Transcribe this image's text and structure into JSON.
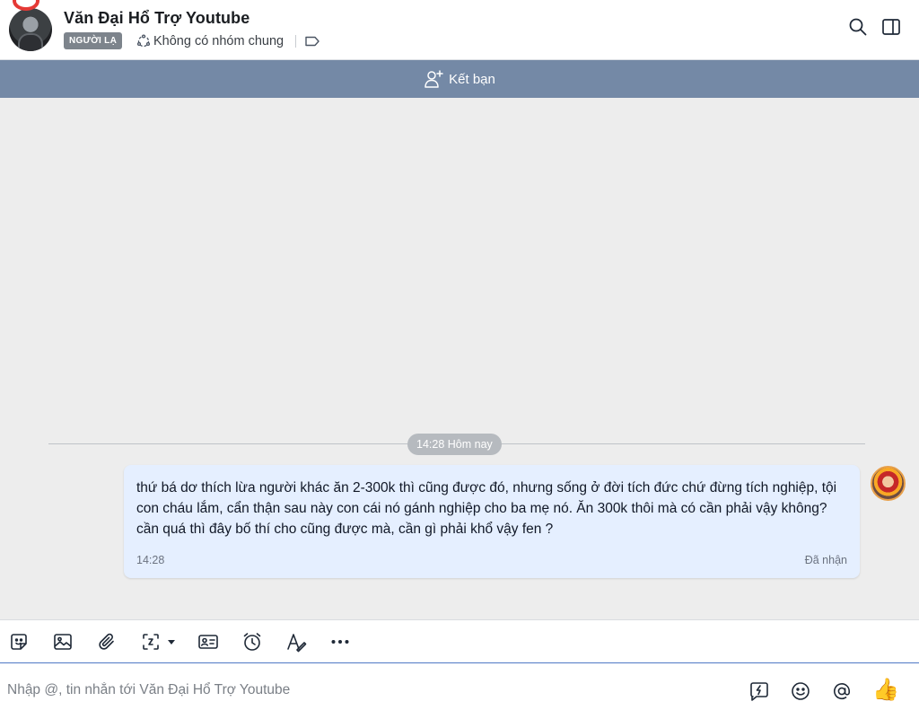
{
  "header": {
    "name": "Văn Đại Hổ Trợ Youtube",
    "badge": "NGƯỜI LẠ",
    "group_info": "Không có nhóm chung",
    "icons": [
      "search-icon",
      "sidebar-toggle-icon",
      "tag-icon",
      "group-icon"
    ]
  },
  "friend_bar": {
    "label": "Kết bạn",
    "color": "#7489a6"
  },
  "chat": {
    "date_divider": "14:28 Hôm nay",
    "messages": [
      {
        "text": "thứ bá dơ thích lừa người khác ăn 2-300k thì cũng được đó, nhưng sống ở đời tích đức chứ đừng tích nghiệp, tội con cháu lắm, cẩn thận sau này con cái nó gánh nghiệp cho ba mẹ nó. Ăn 300k thôi mà có cần phải vậy không? cần quá thì đây bố thí cho cũng được mà, cần gì phải khổ vậy fen ?",
        "time": "14:28",
        "status": "Đã nhận"
      }
    ]
  },
  "toolbar": {
    "items": [
      "sticker-icon",
      "image-icon",
      "attachment-icon",
      "screenshot-icon",
      "contact-card-icon",
      "reminder-icon",
      "text-format-icon",
      "more-icon"
    ]
  },
  "composer": {
    "placeholder": "Nhập @, tin nhắn tới Văn Đại Hổ Trợ Youtube",
    "value": "",
    "thumb": "👍"
  },
  "colors": {
    "bubble": "#e5efff",
    "accent": "#4f79c6"
  }
}
